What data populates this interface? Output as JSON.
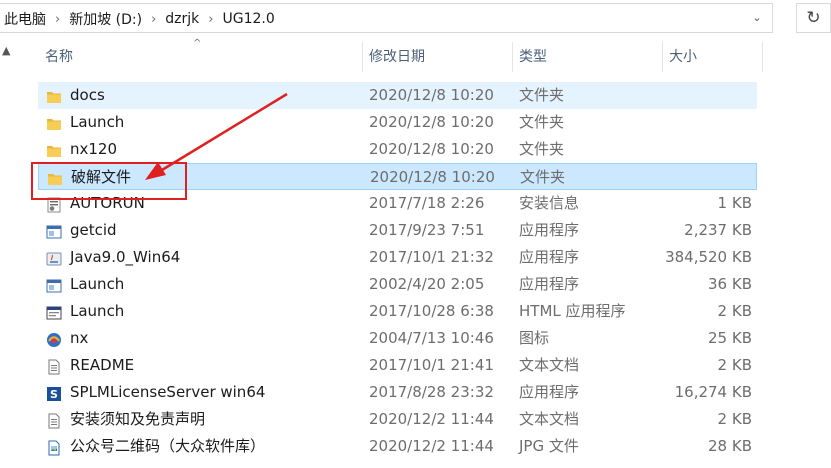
{
  "address": {
    "crumbs": [
      "此电脑",
      "新加坡 (D:)",
      "dzrjk",
      "UG12.0"
    ]
  },
  "columns": {
    "name": "名称",
    "date": "修改日期",
    "type": "类型",
    "size": "大小"
  },
  "rows": [
    {
      "name": "docs",
      "date": "2020/12/8 10:20",
      "type": "文件夹",
      "size": "",
      "icon": "folder-icon"
    },
    {
      "name": "Launch",
      "date": "2020/12/8 10:20",
      "type": "文件夹",
      "size": "",
      "icon": "folder-icon"
    },
    {
      "name": "nx120",
      "date": "2020/12/8 10:20",
      "type": "文件夹",
      "size": "",
      "icon": "folder-icon"
    },
    {
      "name": "破解文件",
      "date": "2020/12/8 10:20",
      "type": "文件夹",
      "size": "",
      "icon": "folder-icon"
    },
    {
      "name": "AUTORUN",
      "date": "2017/7/18 2:26",
      "type": "安装信息",
      "size": "1 KB",
      "icon": "setup-info-icon"
    },
    {
      "name": "getcid",
      "date": "2017/9/23 7:51",
      "type": "应用程序",
      "size": "2,237 KB",
      "icon": "application-icon"
    },
    {
      "name": "Java9.0_Win64",
      "date": "2017/10/1 21:32",
      "type": "应用程序",
      "size": "384,520 KB",
      "icon": "java-installer-icon"
    },
    {
      "name": "Launch",
      "date": "2002/4/20 2:05",
      "type": "应用程序",
      "size": "36 KB",
      "icon": "application-icon"
    },
    {
      "name": "Launch",
      "date": "2017/10/28 6:38",
      "type": "HTML 应用程序",
      "size": "2 KB",
      "icon": "hta-icon"
    },
    {
      "name": "nx",
      "date": "2004/7/13 10:46",
      "type": "图标",
      "size": "25 KB",
      "icon": "nx-icon"
    },
    {
      "name": "README",
      "date": "2017/10/1 21:41",
      "type": "文本文档",
      "size": "2 KB",
      "icon": "text-document-icon"
    },
    {
      "name": "SPLMLicenseServer win64",
      "date": "2017/8/28 23:32",
      "type": "应用程序",
      "size": "16,274 KB",
      "icon": "license-server-icon"
    },
    {
      "name": "安装须知及免责声明",
      "date": "2020/12/2 11:44",
      "type": "文本文档",
      "size": "2 KB",
      "icon": "text-document-icon"
    },
    {
      "name": "公众号二维码（大众软件库）",
      "date": "2020/12/2 11:44",
      "type": "JPG 文件",
      "size": "28 KB",
      "icon": "image-file-icon"
    }
  ],
  "colors": {
    "highlight_box": "#e02020",
    "selection": "#cce8ff",
    "hover": "#e5f3ff",
    "folder": "#f3c544"
  }
}
